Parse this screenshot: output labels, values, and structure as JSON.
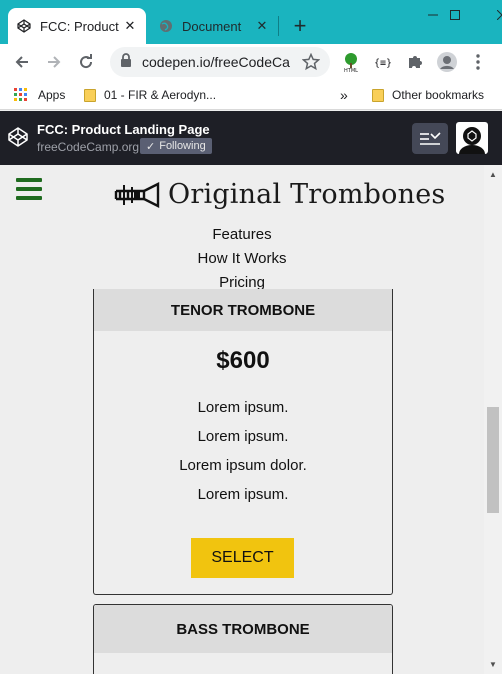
{
  "browser": {
    "tabs": [
      {
        "title": "FCC: Product La"
      },
      {
        "title": "Document"
      }
    ],
    "url": "codepen.io/freeCodeCamp",
    "bookmarks": [
      {
        "label": "Apps"
      },
      {
        "label": "01 - FIR & Aerodyn..."
      },
      {
        "label": "Other bookmarks"
      }
    ],
    "chevron": "»",
    "accent_color": "#1ab4bf"
  },
  "codepen": {
    "title": "FCC: Product Landing Page",
    "user": "freeCodeCamp.org",
    "follow_label": "Following"
  },
  "page": {
    "brand": "Original Trombones",
    "nav": [
      "Features",
      "How It Works",
      "Pricing"
    ],
    "cards": [
      {
        "name": "TENOR TROMBONE",
        "price": "$600",
        "features": [
          "Lorem ipsum.",
          "Lorem ipsum.",
          "Lorem ipsum dolor.",
          "Lorem ipsum."
        ],
        "button": "SELECT"
      },
      {
        "name": "BASS TROMBONE"
      }
    ],
    "button_color": "#f1c40f"
  }
}
